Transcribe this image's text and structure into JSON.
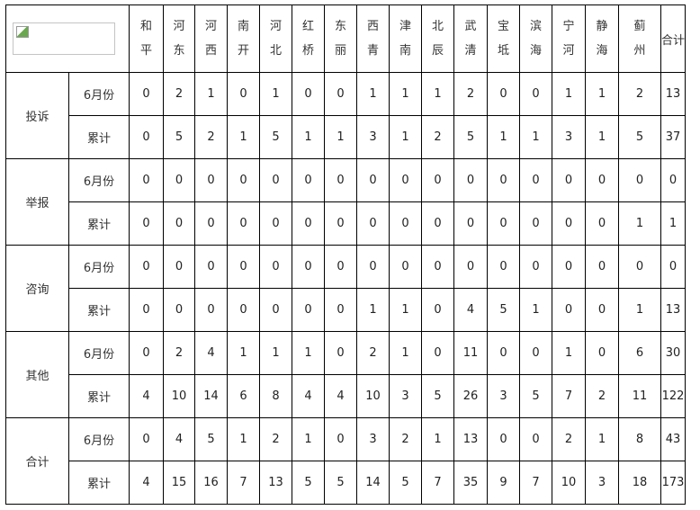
{
  "districts": [
    "和平",
    "河东",
    "河西",
    "南开",
    "河北",
    "红桥",
    "东丽",
    "西青",
    "津南",
    "北辰",
    "武清",
    "宝坻",
    "滨海",
    "宁河",
    "静海",
    "蓟州"
  ],
  "total_label": "合计",
  "rows": [
    {
      "category": "投诉",
      "items": [
        {
          "label": "6月份",
          "values": [
            "0",
            "2",
            "1",
            "0",
            "1",
            "0",
            "0",
            "1",
            "1",
            "1",
            "2",
            "0",
            "0",
            "1",
            "1",
            "2",
            "13"
          ]
        },
        {
          "label": "累计",
          "values": [
            "0",
            "5",
            "2",
            "1",
            "5",
            "1",
            "1",
            "3",
            "1",
            "2",
            "5",
            "1",
            "1",
            "3",
            "1",
            "5",
            "37"
          ]
        }
      ]
    },
    {
      "category": "举报",
      "items": [
        {
          "label": "6月份",
          "values": [
            "0",
            "0",
            "0",
            "0",
            "0",
            "0",
            "0",
            "0",
            "0",
            "0",
            "0",
            "0",
            "0",
            "0",
            "0",
            "0",
            "0"
          ]
        },
        {
          "label": "累计",
          "values": [
            "0",
            "0",
            "0",
            "0",
            "0",
            "0",
            "0",
            "0",
            "0",
            "0",
            "0",
            "0",
            "0",
            "0",
            "0",
            "1",
            "1"
          ]
        }
      ]
    },
    {
      "category": "咨询",
      "items": [
        {
          "label": "6月份",
          "values": [
            "0",
            "0",
            "0",
            "0",
            "0",
            "0",
            "0",
            "0",
            "0",
            "0",
            "0",
            "0",
            "0",
            "0",
            "0",
            "0",
            "0"
          ]
        },
        {
          "label": "累计",
          "values": [
            "0",
            "0",
            "0",
            "0",
            "0",
            "0",
            "0",
            "1",
            "1",
            "0",
            "4",
            "5",
            "1",
            "0",
            "0",
            "1",
            "13"
          ]
        }
      ]
    },
    {
      "category": "其他",
      "items": [
        {
          "label": "6月份",
          "values": [
            "0",
            "2",
            "4",
            "1",
            "1",
            "1",
            "0",
            "2",
            "1",
            "0",
            "11",
            "0",
            "0",
            "1",
            "0",
            "6",
            "30"
          ]
        },
        {
          "label": "累计",
          "values": [
            "4",
            "10",
            "14",
            "6",
            "8",
            "4",
            "4",
            "10",
            "3",
            "5",
            "26",
            "3",
            "5",
            "7",
            "2",
            "11",
            "122"
          ]
        }
      ]
    },
    {
      "category": "合计",
      "items": [
        {
          "label": "6月份",
          "values": [
            "0",
            "4",
            "5",
            "1",
            "2",
            "1",
            "0",
            "3",
            "2",
            "1",
            "13",
            "0",
            "0",
            "2",
            "1",
            "8",
            "43"
          ]
        },
        {
          "label": "累计",
          "values": [
            "4",
            "15",
            "16",
            "7",
            "13",
            "5",
            "5",
            "14",
            "5",
            "7",
            "35",
            "9",
            "7",
            "10",
            "3",
            "18",
            "173"
          ]
        }
      ]
    }
  ]
}
